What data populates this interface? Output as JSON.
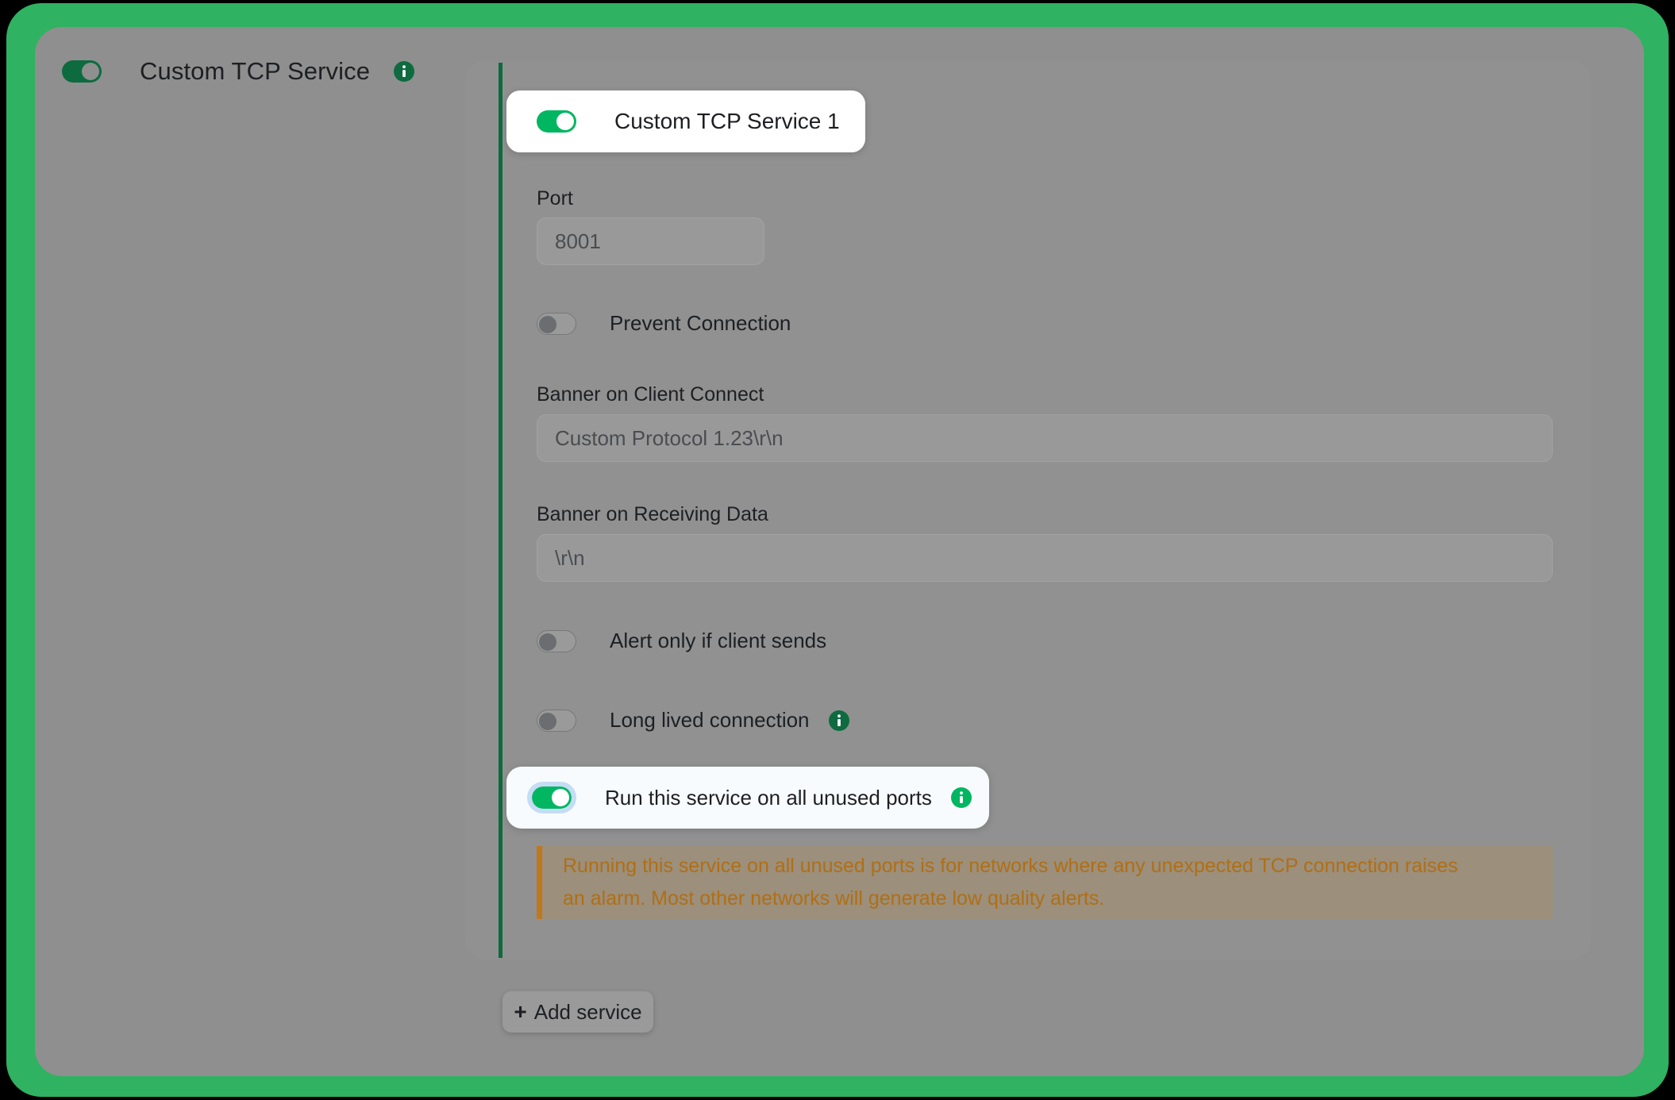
{
  "header": {
    "toggle_state": "on",
    "title": "Custom TCP Service",
    "info_icon": "info-icon"
  },
  "service": {
    "toggle_state": "on",
    "name": "Custom TCP Service 1"
  },
  "fields": {
    "port": {
      "label": "Port",
      "value": "8001"
    },
    "banner_client_connect": {
      "label": "Banner on Client Connect",
      "value": "Custom Protocol 1.23\\r\\n"
    },
    "banner_receiving_data": {
      "label": "Banner on Receiving Data",
      "value": "\\r\\n"
    }
  },
  "toggles": {
    "prevent_connection": {
      "label": "Prevent Connection",
      "state": "off"
    },
    "alert_only_if_client_sends": {
      "label": "Alert only if client sends",
      "state": "off"
    },
    "long_lived_connection": {
      "label": "Long lived connection",
      "state": "off",
      "info_icon": "info-icon"
    },
    "run_on_all_unused_ports": {
      "label": "Run this service on all unused ports",
      "state": "on",
      "info_icon": "info-icon"
    }
  },
  "warning": {
    "line1": "Running this service on all unused ports is for networks where any unexpected TCP connection raises",
    "line2": "an alarm. Most other networks will generate low quality alerts."
  },
  "buttons": {
    "add_service": {
      "plus": "+",
      "label": "Add service"
    }
  },
  "colors": {
    "frame_green": "#2fb261",
    "accent_green_dark": "#0d6b3f",
    "toggle_green_bright": "#00b661",
    "warning_text": "#b06f14",
    "warning_border": "#c0781c",
    "focus_ring": "#c5dcf5"
  }
}
